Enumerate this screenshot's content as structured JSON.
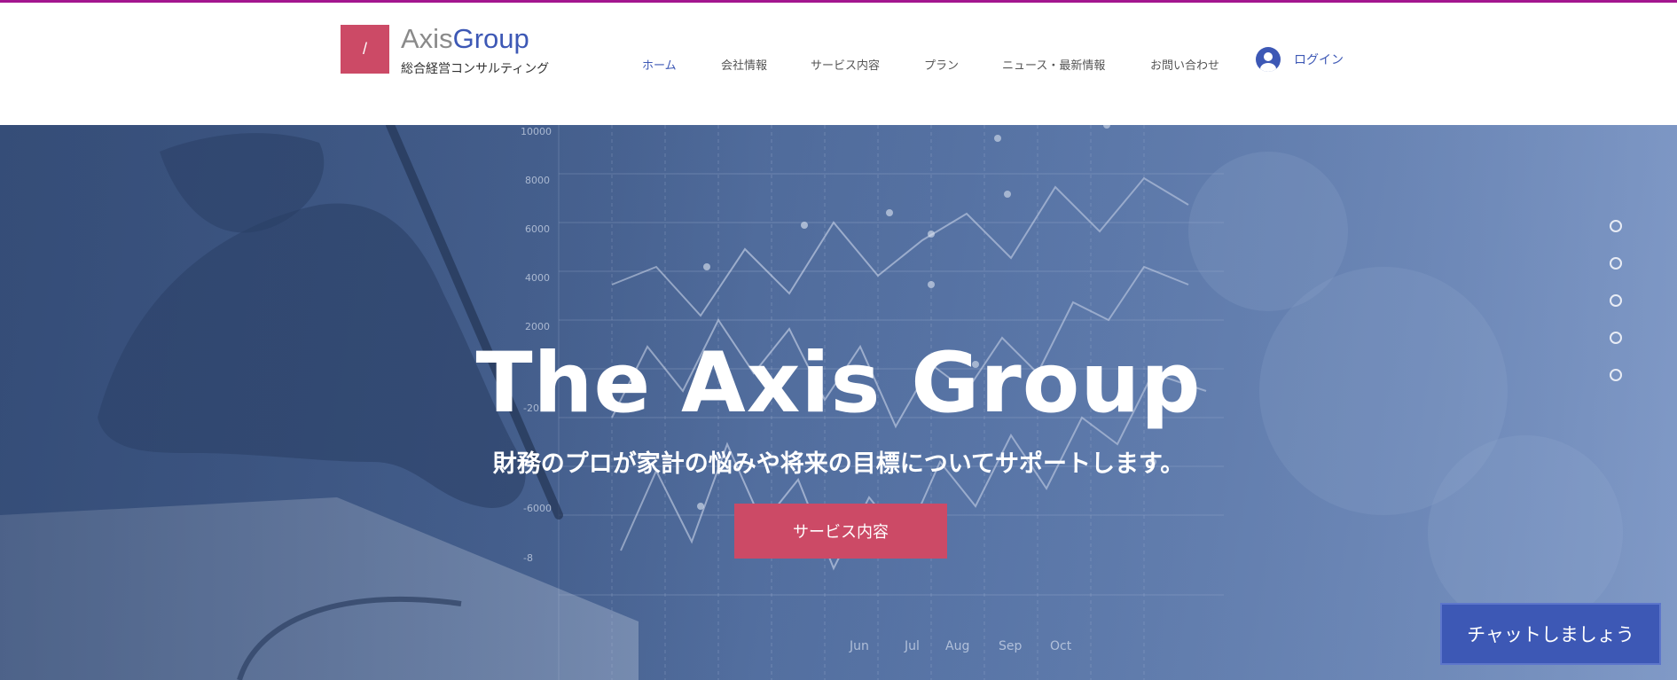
{
  "colors": {
    "accent": "#cc4a66",
    "brand": "#3d58b5",
    "top_line": "#a3168f"
  },
  "header": {
    "logo_glyph": "/",
    "brand_part1": "Axis",
    "brand_part2": "Group",
    "tagline": "総合経営コンサルティング",
    "nav": [
      {
        "label": "ホーム",
        "active": true
      },
      {
        "label": "会社情報",
        "active": false
      },
      {
        "label": "サービス内容",
        "active": false
      },
      {
        "label": "プラン",
        "active": false
      },
      {
        "label": "ニュース・最新情報",
        "active": false
      },
      {
        "label": "お問い合わせ",
        "active": false
      }
    ],
    "login": {
      "label": "ログイン",
      "icon": "user-avatar-icon"
    }
  },
  "hero": {
    "title": "The Axis Group",
    "subtitle": "財務のプロが家計の悩みや将来の目標についてサポートします。",
    "cta_label": "サービス内容",
    "background_chart": {
      "y_ticks": [
        "10000",
        "8000",
        "6000",
        "4000",
        "2000",
        "-20",
        "-6000",
        "-8"
      ],
      "x_ticks": [
        "Jun",
        "Jul",
        "Aug",
        "Sep",
        "Oct"
      ]
    },
    "slide_count": 5
  },
  "chat": {
    "label": "チャットしましょう"
  }
}
